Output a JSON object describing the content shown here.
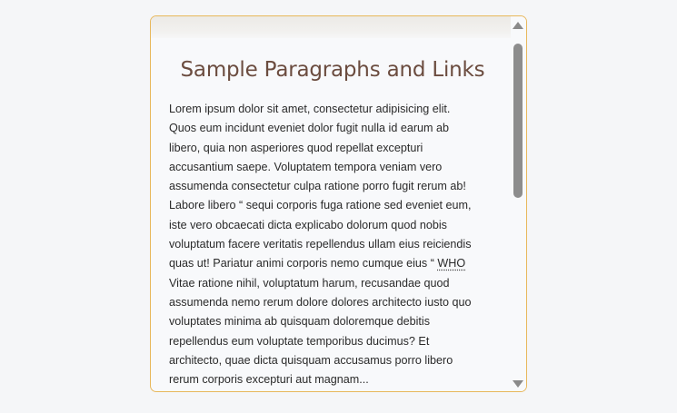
{
  "article": {
    "title": "Sample Paragraphs and Links",
    "lines": [
      "Lorem ipsum dolor sit amet, consectetur adipisicing elit.",
      "Quos eum incidunt eveniet dolor fugit nulla id earum ab",
      "libero, quia non asperiores quod repellat excepturi",
      "accusantium saepe. Voluptatem tempora veniam vero",
      "assumenda consectetur culpa ratione porro fugit rerum ab!",
      "Labore libero “ sequi corporis fuga ratione sed eveniet eum,",
      "iste vero obcaecati dicta explicabo dolorum quod nobis",
      "voluptatum facere veritatis repellendus ullam eius reiciendis",
      "quas ut! Pariatur animi corporis nemo cumque eius “",
      "Vitae ratione nihil, voluptatum harum, recusandae quod",
      "assumenda nemo rerum dolore dolores architecto iusto quo",
      "voluptates minima ab quisquam doloremque debitis",
      "repellendus eum voluptate temporibus ducimus? Et",
      "architecto, quae dicta quisquam accusamus porro libero",
      "rerum corporis excepturi aut magnam..."
    ],
    "abbr_text": "WHO"
  },
  "scrollbar": {
    "up_icon": "arrow-up-icon",
    "down_icon": "arrow-down-icon",
    "position_fraction": 0.0
  },
  "colors": {
    "border": "#e8b85c",
    "title": "#6b4c3f",
    "text": "#2a2a2a",
    "scroll_thumb": "#8d8d8d"
  }
}
